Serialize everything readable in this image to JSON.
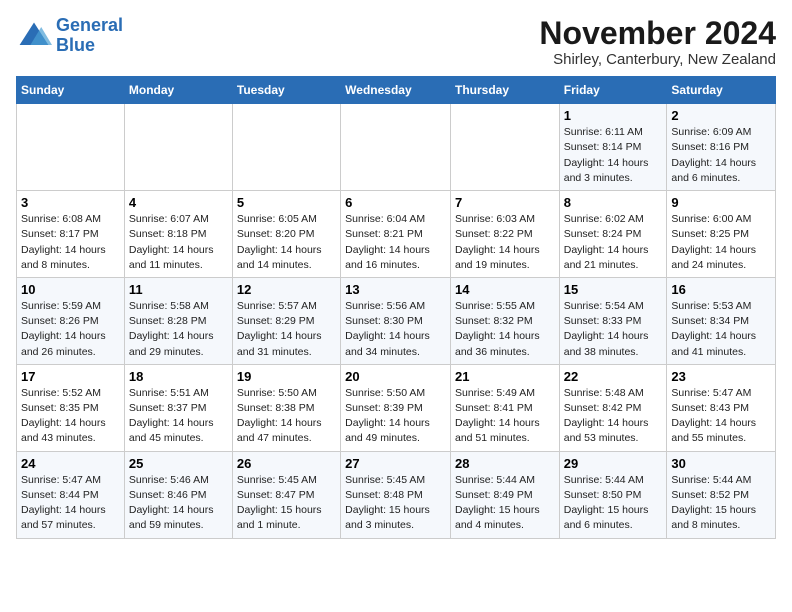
{
  "logo": {
    "line1": "General",
    "line2": "Blue"
  },
  "title": "November 2024",
  "subtitle": "Shirley, Canterbury, New Zealand",
  "days_of_week": [
    "Sunday",
    "Monday",
    "Tuesday",
    "Wednesday",
    "Thursday",
    "Friday",
    "Saturday"
  ],
  "weeks": [
    [
      {
        "num": "",
        "info": ""
      },
      {
        "num": "",
        "info": ""
      },
      {
        "num": "",
        "info": ""
      },
      {
        "num": "",
        "info": ""
      },
      {
        "num": "",
        "info": ""
      },
      {
        "num": "1",
        "info": "Sunrise: 6:11 AM\nSunset: 8:14 PM\nDaylight: 14 hours and 3 minutes."
      },
      {
        "num": "2",
        "info": "Sunrise: 6:09 AM\nSunset: 8:16 PM\nDaylight: 14 hours and 6 minutes."
      }
    ],
    [
      {
        "num": "3",
        "info": "Sunrise: 6:08 AM\nSunset: 8:17 PM\nDaylight: 14 hours and 8 minutes."
      },
      {
        "num": "4",
        "info": "Sunrise: 6:07 AM\nSunset: 8:18 PM\nDaylight: 14 hours and 11 minutes."
      },
      {
        "num": "5",
        "info": "Sunrise: 6:05 AM\nSunset: 8:20 PM\nDaylight: 14 hours and 14 minutes."
      },
      {
        "num": "6",
        "info": "Sunrise: 6:04 AM\nSunset: 8:21 PM\nDaylight: 14 hours and 16 minutes."
      },
      {
        "num": "7",
        "info": "Sunrise: 6:03 AM\nSunset: 8:22 PM\nDaylight: 14 hours and 19 minutes."
      },
      {
        "num": "8",
        "info": "Sunrise: 6:02 AM\nSunset: 8:24 PM\nDaylight: 14 hours and 21 minutes."
      },
      {
        "num": "9",
        "info": "Sunrise: 6:00 AM\nSunset: 8:25 PM\nDaylight: 14 hours and 24 minutes."
      }
    ],
    [
      {
        "num": "10",
        "info": "Sunrise: 5:59 AM\nSunset: 8:26 PM\nDaylight: 14 hours and 26 minutes."
      },
      {
        "num": "11",
        "info": "Sunrise: 5:58 AM\nSunset: 8:28 PM\nDaylight: 14 hours and 29 minutes."
      },
      {
        "num": "12",
        "info": "Sunrise: 5:57 AM\nSunset: 8:29 PM\nDaylight: 14 hours and 31 minutes."
      },
      {
        "num": "13",
        "info": "Sunrise: 5:56 AM\nSunset: 8:30 PM\nDaylight: 14 hours and 34 minutes."
      },
      {
        "num": "14",
        "info": "Sunrise: 5:55 AM\nSunset: 8:32 PM\nDaylight: 14 hours and 36 minutes."
      },
      {
        "num": "15",
        "info": "Sunrise: 5:54 AM\nSunset: 8:33 PM\nDaylight: 14 hours and 38 minutes."
      },
      {
        "num": "16",
        "info": "Sunrise: 5:53 AM\nSunset: 8:34 PM\nDaylight: 14 hours and 41 minutes."
      }
    ],
    [
      {
        "num": "17",
        "info": "Sunrise: 5:52 AM\nSunset: 8:35 PM\nDaylight: 14 hours and 43 minutes."
      },
      {
        "num": "18",
        "info": "Sunrise: 5:51 AM\nSunset: 8:37 PM\nDaylight: 14 hours and 45 minutes."
      },
      {
        "num": "19",
        "info": "Sunrise: 5:50 AM\nSunset: 8:38 PM\nDaylight: 14 hours and 47 minutes."
      },
      {
        "num": "20",
        "info": "Sunrise: 5:50 AM\nSunset: 8:39 PM\nDaylight: 14 hours and 49 minutes."
      },
      {
        "num": "21",
        "info": "Sunrise: 5:49 AM\nSunset: 8:41 PM\nDaylight: 14 hours and 51 minutes."
      },
      {
        "num": "22",
        "info": "Sunrise: 5:48 AM\nSunset: 8:42 PM\nDaylight: 14 hours and 53 minutes."
      },
      {
        "num": "23",
        "info": "Sunrise: 5:47 AM\nSunset: 8:43 PM\nDaylight: 14 hours and 55 minutes."
      }
    ],
    [
      {
        "num": "24",
        "info": "Sunrise: 5:47 AM\nSunset: 8:44 PM\nDaylight: 14 hours and 57 minutes."
      },
      {
        "num": "25",
        "info": "Sunrise: 5:46 AM\nSunset: 8:46 PM\nDaylight: 14 hours and 59 minutes."
      },
      {
        "num": "26",
        "info": "Sunrise: 5:45 AM\nSunset: 8:47 PM\nDaylight: 15 hours and 1 minute."
      },
      {
        "num": "27",
        "info": "Sunrise: 5:45 AM\nSunset: 8:48 PM\nDaylight: 15 hours and 3 minutes."
      },
      {
        "num": "28",
        "info": "Sunrise: 5:44 AM\nSunset: 8:49 PM\nDaylight: 15 hours and 4 minutes."
      },
      {
        "num": "29",
        "info": "Sunrise: 5:44 AM\nSunset: 8:50 PM\nDaylight: 15 hours and 6 minutes."
      },
      {
        "num": "30",
        "info": "Sunrise: 5:44 AM\nSunset: 8:52 PM\nDaylight: 15 hours and 8 minutes."
      }
    ]
  ]
}
